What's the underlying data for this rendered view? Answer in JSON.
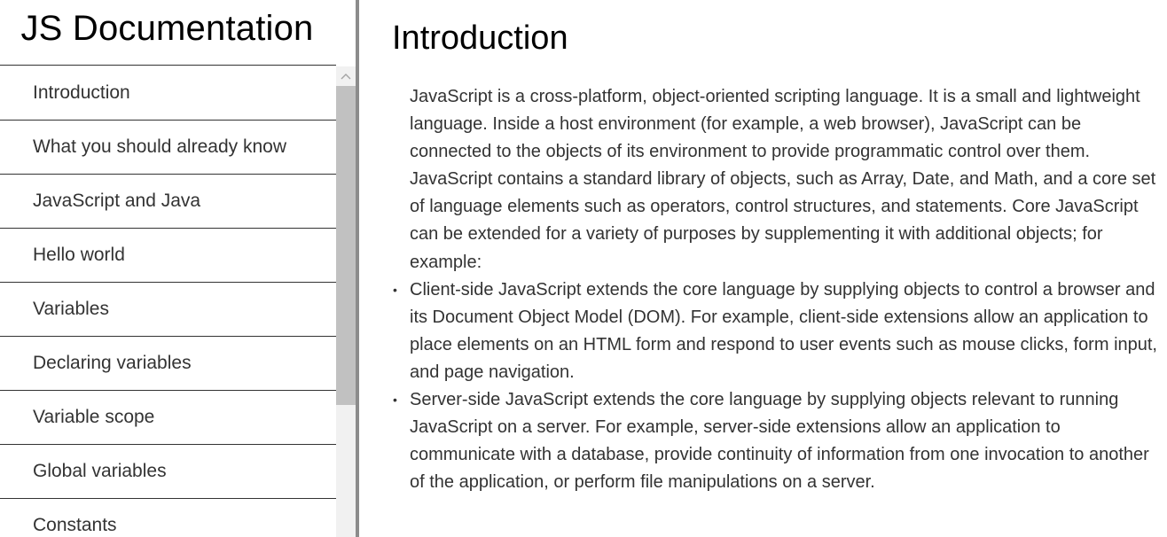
{
  "navbar": {
    "title": "JS Documentation",
    "items": [
      {
        "label": "Introduction"
      },
      {
        "label": "What you should already know"
      },
      {
        "label": "JavaScript and Java"
      },
      {
        "label": "Hello world"
      },
      {
        "label": "Variables"
      },
      {
        "label": "Declaring variables"
      },
      {
        "label": "Variable scope"
      },
      {
        "label": "Global variables"
      },
      {
        "label": "Constants"
      }
    ]
  },
  "main": {
    "section_title": "Introduction",
    "paragraphs": [
      "JavaScript is a cross-platform, object-oriented scripting language. It is a small and lightweight language. Inside a host environment (for example, a web browser), JavaScript can be connected to the objects of its environment to provide programmatic control over them.",
      "JavaScript contains a standard library of objects, such as Array, Date, and Math, and a core set of language elements such as operators, control structures, and statements. Core JavaScript can be extended for a variety of purposes by supplementing it with additional objects; for example:"
    ],
    "bullets": [
      "Client-side JavaScript extends the core language by supplying objects to control a browser and its Document Object Model (DOM). For example, client-side extensions allow an application to place elements on an HTML form and respond to user events such as mouse clicks, form input, and page navigation.",
      "Server-side JavaScript extends the core language by supplying objects relevant to running JavaScript on a server. For example, server-side extensions allow an application to communicate with a database, provide continuity of information from one invocation to another of the application, or perform file manipulations on a server."
    ],
    "bullet_glyph": "•"
  },
  "icons": {
    "scroll_up": "chevron-up-icon"
  }
}
